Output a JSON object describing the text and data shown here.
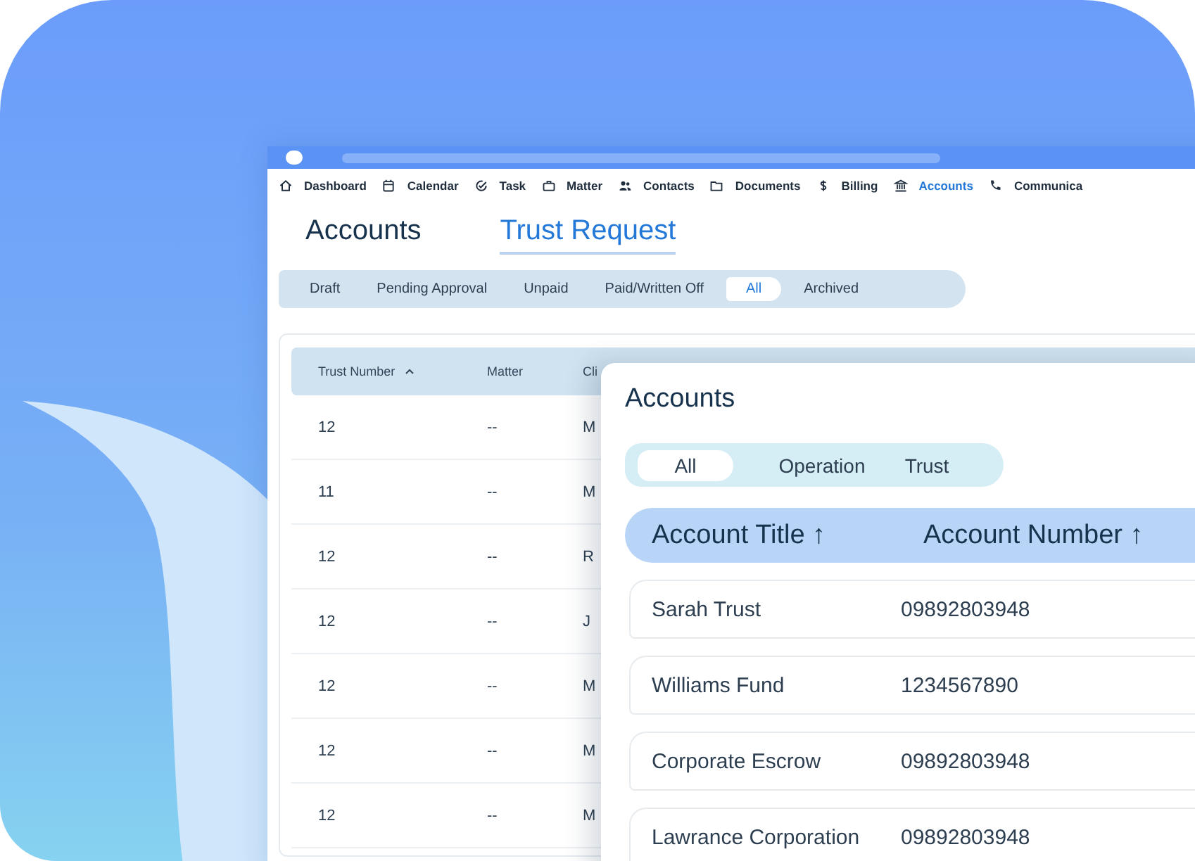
{
  "nav": [
    {
      "label": "Dashboard",
      "selected": false
    },
    {
      "label": "Calendar",
      "selected": false
    },
    {
      "label": "Task",
      "selected": false
    },
    {
      "label": "Matter",
      "selected": false
    },
    {
      "label": "Contacts",
      "selected": false
    },
    {
      "label": "Documents",
      "selected": false
    },
    {
      "label": "Billing",
      "selected": false
    },
    {
      "label": "Accounts",
      "selected": true
    },
    {
      "label": "Communica",
      "selected": false
    }
  ],
  "page_tabs": [
    {
      "label": "Accounts",
      "selected": false
    },
    {
      "label": "Trust Request",
      "selected": true
    }
  ],
  "filters": [
    {
      "label": "Draft",
      "selected": false
    },
    {
      "label": "Pending Approval",
      "selected": false
    },
    {
      "label": "Unpaid",
      "selected": false
    },
    {
      "label": "Paid/Written Off",
      "selected": false
    },
    {
      "label": "All",
      "selected": true
    },
    {
      "label": "Archived",
      "selected": false
    }
  ],
  "table": {
    "columns": [
      "Trust Number",
      "Matter",
      "Cli"
    ],
    "rows": [
      [
        "12",
        "--",
        "M"
      ],
      [
        "11",
        "--",
        "M"
      ],
      [
        "12",
        "--",
        "R"
      ],
      [
        "12",
        "--",
        "J"
      ],
      [
        "12",
        "--",
        "M"
      ],
      [
        "12",
        "--",
        "M"
      ],
      [
        "12",
        "--",
        "M"
      ]
    ]
  },
  "accounts_panel": {
    "title": "Accounts",
    "segments": [
      {
        "label": "All",
        "selected": true
      },
      {
        "label": "Operation",
        "selected": false
      },
      {
        "label": "Trust",
        "selected": false
      }
    ],
    "columns": [
      "Account Title ↑",
      "Account Number ↑"
    ],
    "rows": [
      [
        "Sarah Trust",
        "09892803948"
      ],
      [
        "Williams Fund",
        "1234567890"
      ],
      [
        "Corporate Escrow",
        "09892803948"
      ],
      [
        "Lawrance Corporation",
        "09892803948"
      ]
    ]
  }
}
